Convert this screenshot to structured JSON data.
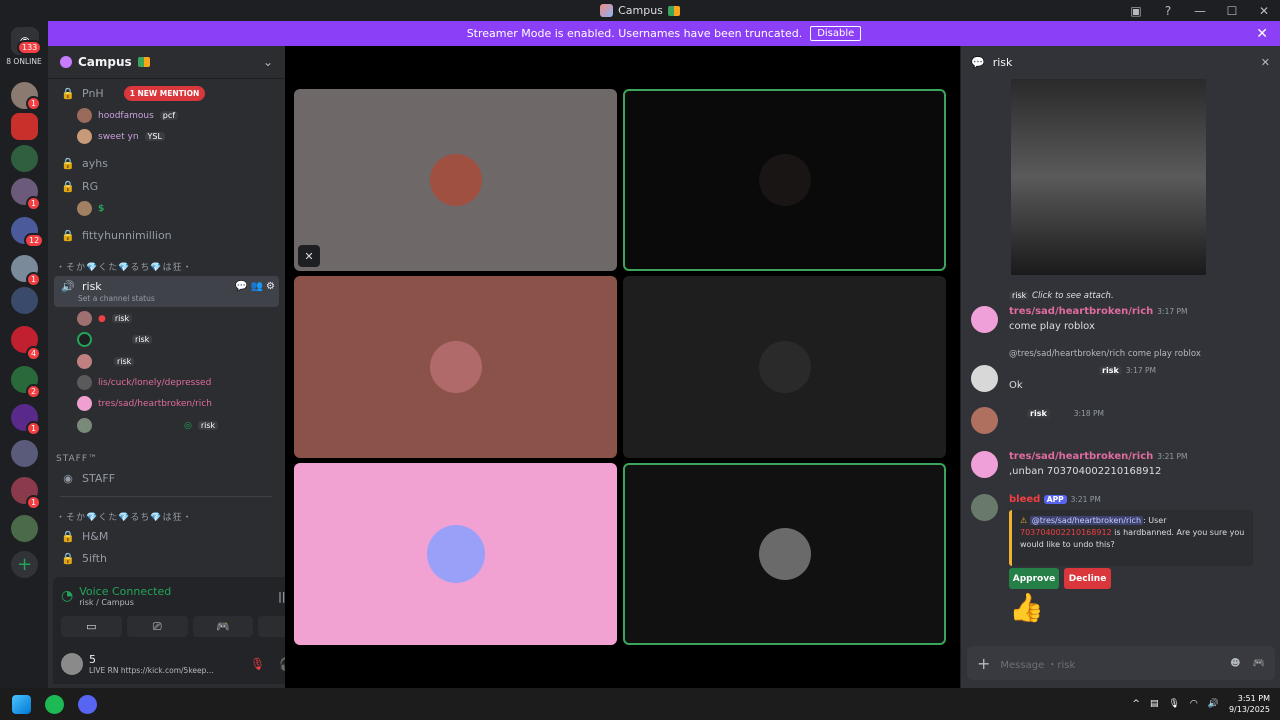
{
  "window": {
    "title": "Campus",
    "min": "—",
    "max": "☐",
    "close": "✕"
  },
  "banner": {
    "text": "Streamer Mode is enabled. Usernames have been truncated.",
    "disable": "Disable"
  },
  "guilds": {
    "home_badge": "133",
    "online": "8 ONLINE",
    "badges": [
      "1",
      "1",
      "12",
      "1",
      "4",
      "2",
      "1",
      "1"
    ]
  },
  "server": {
    "name": "Campus"
  },
  "channels": {
    "pnh": "PnH",
    "mention": "1 NEW MENTION",
    "pnh_users": [
      {
        "name": "hoodfamous",
        "tag": "pcf"
      },
      {
        "name": "sweet yn",
        "tag": "YSL"
      }
    ],
    "ayhs": "ayhs",
    "rg": "RG",
    "rg_user": "$",
    "fitty": "fittyhunnimillion",
    "category1": "・そか💎くた💎るち💎は狂・",
    "risk": "risk",
    "risk_status": "Set a channel status",
    "risk_users": [
      {
        "name": "",
        "tag": "risk"
      },
      {
        "name": "",
        "tag": "risk"
      },
      {
        "name": "",
        "tag": "risk"
      },
      {
        "name": "lis/cuck/lonely/depressed",
        "tag": ""
      },
      {
        "name": "tres/sad/heartbroken/rich",
        "tag": ""
      },
      {
        "name": "",
        "tag": "risk"
      }
    ],
    "staff_cat": "STAFF™",
    "staff": "STAFF",
    "category2": "・そか💎くた💎るち💎は狂・",
    "hm": "H&M",
    "fifth": "5ifth"
  },
  "voice": {
    "status": "Voice Connected",
    "location": "risk / Campus"
  },
  "user": {
    "name": "5",
    "status": "LIVE RN https://kick.com/5keep..."
  },
  "chat": {
    "channel": "risk",
    "click_attach": "Click to see attach.",
    "tag": "risk",
    "messages": [
      {
        "author": "tres/sad/heartbroken/rich",
        "time": "3:17 PM",
        "text": "come play roblox"
      },
      {
        "reply": "@tres/sad/heartbroken/rich come play roblox",
        "time": "3:17 PM",
        "text": "Ok"
      },
      {
        "time": "3:18 PM",
        "text": ""
      },
      {
        "author": "tres/sad/heartbroken/rich",
        "time": "3:21 PM",
        "text": ",unban 703704002210168912"
      },
      {
        "author": "bleed",
        "app": "APP",
        "time": "3:21 PM"
      }
    ],
    "embed": {
      "mention": "@tres/sad/heartbroken/rich",
      "pre": "User",
      "id": "703704002210168912",
      "post": "is hardbanned. Are you sure you would like to undo this?"
    },
    "approve": "Approve",
    "decline": "Decline",
    "emoji": "👍",
    "placeholder": "Message ・risk"
  },
  "taskbar": {
    "time": "3:51 PM",
    "date": "9/13/2025"
  },
  "colors": {
    "accent": "#8b3ff7",
    "speaking": "#3ba55d",
    "danger": "#da373c",
    "approve": "#248046"
  }
}
